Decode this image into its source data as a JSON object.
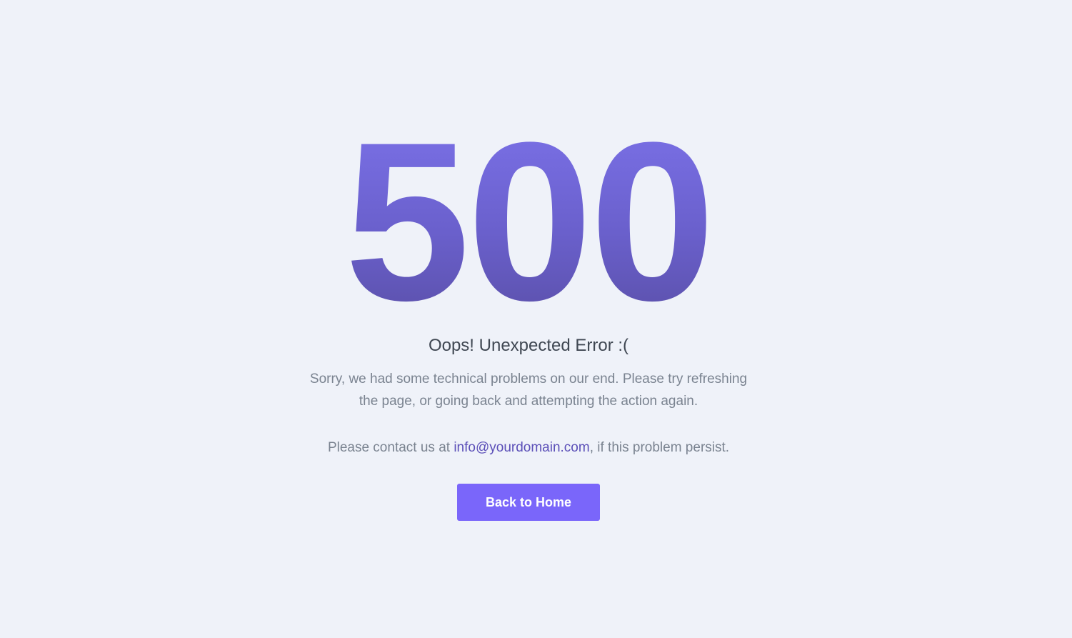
{
  "error": {
    "code": "500",
    "title": "Oops! Unexpected Error :(",
    "description": "Sorry, we had some technical problems on our end. Please try refreshing the page, or going back and attempting the action again.",
    "contact_prefix": "Please contact us at ",
    "contact_email": "info@yourdomain.com",
    "contact_suffix": ", if this problem persist."
  },
  "actions": {
    "back_home_label": "Back to Home"
  },
  "colors": {
    "background": "#eff2f9",
    "accent": "#7a66fa",
    "link": "#5b4fb8",
    "code_gradient_top": "#7b71e8",
    "code_gradient_bottom": "#5a4fa8"
  }
}
